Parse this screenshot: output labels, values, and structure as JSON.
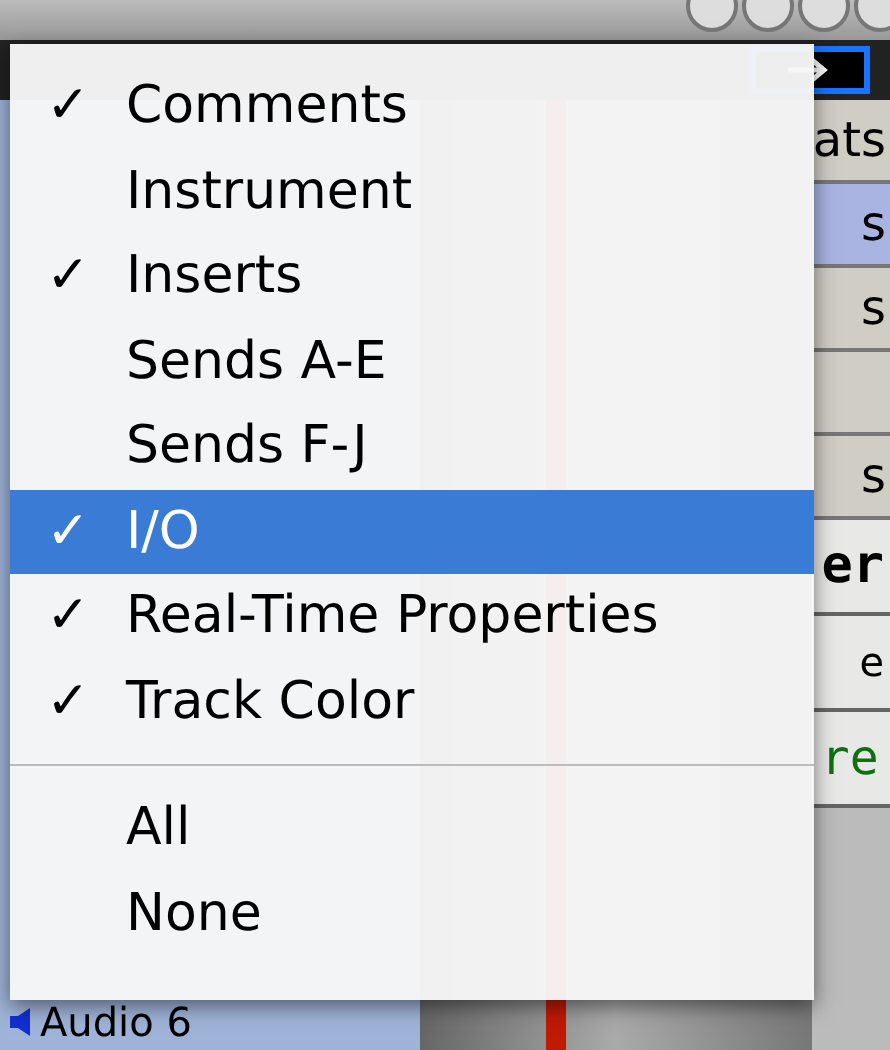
{
  "menu": {
    "items": [
      {
        "label": "Comments",
        "checked": true,
        "selected": false
      },
      {
        "label": "Instrument",
        "checked": false,
        "selected": false
      },
      {
        "label": "Inserts",
        "checked": true,
        "selected": false
      },
      {
        "label": "Sends A-E",
        "checked": false,
        "selected": false
      },
      {
        "label": "Sends F-J",
        "checked": false,
        "selected": false
      },
      {
        "label": "I/O",
        "checked": true,
        "selected": true
      },
      {
        "label": "Real-Time Properties",
        "checked": true,
        "selected": false
      },
      {
        "label": "Track Color",
        "checked": true,
        "selected": false
      }
    ],
    "check_mark": "✓",
    "actions": [
      {
        "label": "All"
      },
      {
        "label": "None"
      }
    ]
  },
  "side_column": [
    {
      "text": "ats",
      "selected": false
    },
    {
      "text": "s",
      "selected": true
    },
    {
      "text": "s",
      "selected": false
    },
    {
      "selected": false
    },
    {
      "text": "s",
      "selected": false
    }
  ],
  "track_fragments": [
    {
      "text": "er",
      "kind": "name"
    },
    {
      "text": "e",
      "kind": "label"
    },
    {
      "text": "re",
      "kind": "value"
    }
  ],
  "track_list": {
    "visible_track": "Audio 6"
  }
}
